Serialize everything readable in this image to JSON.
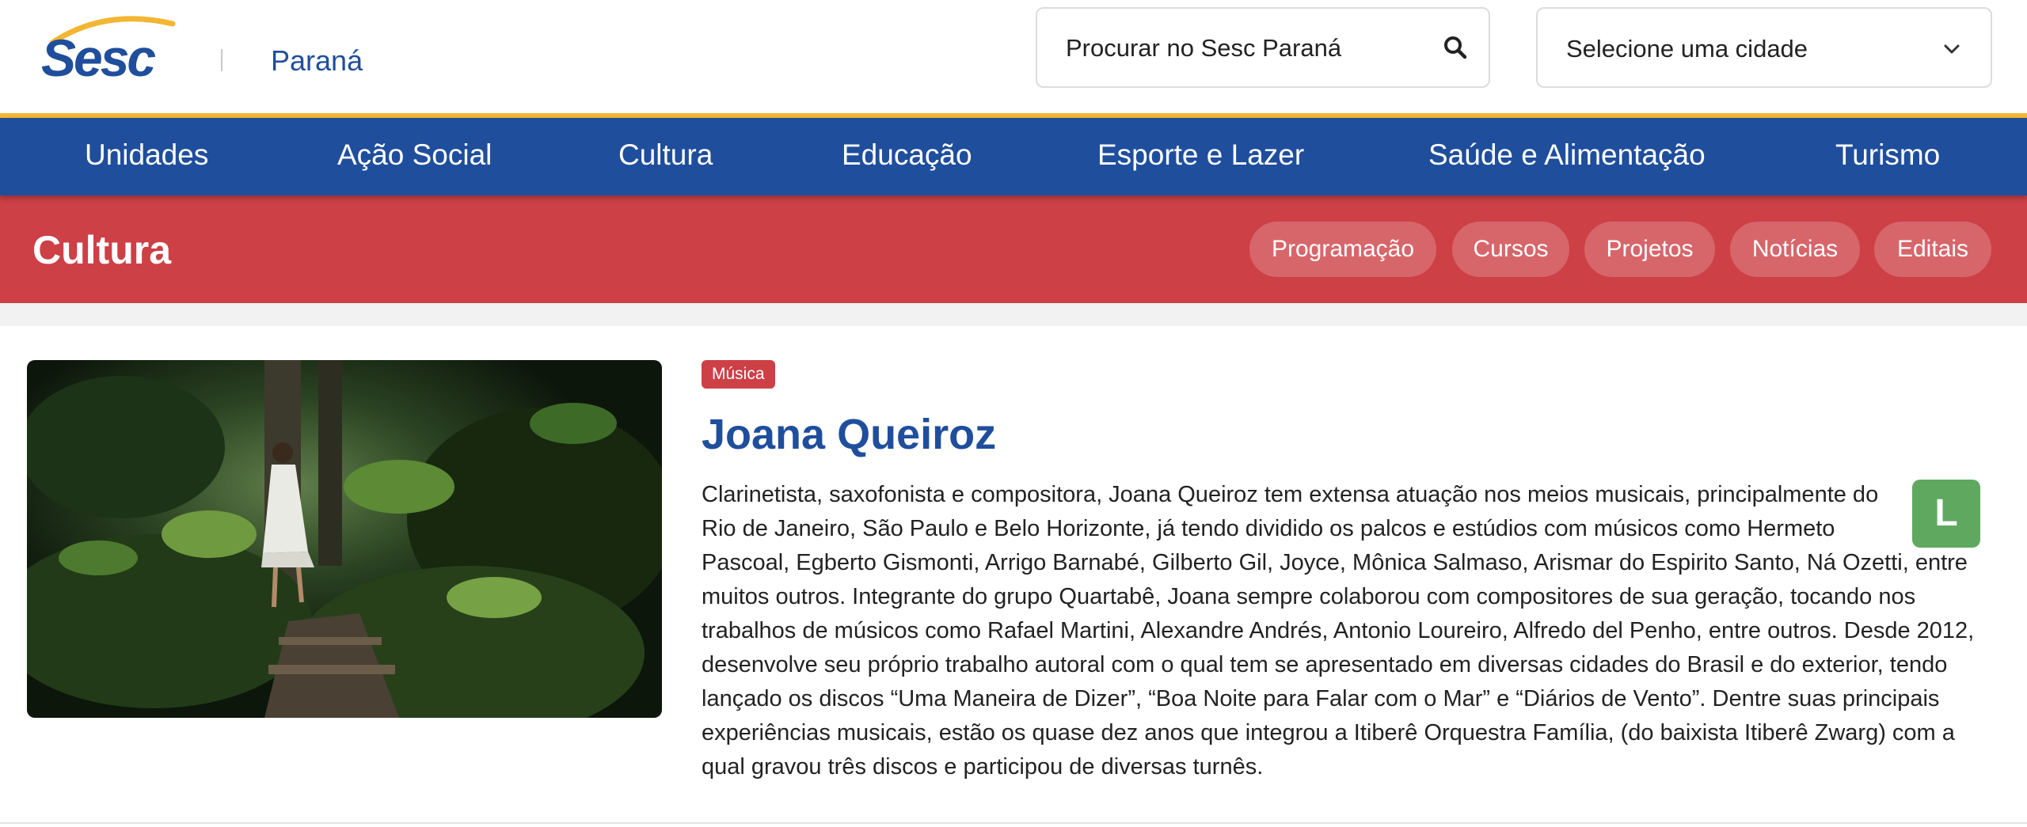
{
  "header": {
    "logo_text": "Sesc",
    "region": "Paraná",
    "search_placeholder": "Procurar no Sesc Paraná",
    "city_select": "Selecione uma cidade"
  },
  "main_nav": [
    "Unidades",
    "Ação Social",
    "Cultura",
    "Educação",
    "Esporte e Lazer",
    "Saúde e Alimentação",
    "Turismo"
  ],
  "section": {
    "title": "Cultura",
    "links": [
      "Programação",
      "Cursos",
      "Projetos",
      "Notícias",
      "Editais"
    ]
  },
  "article": {
    "tag": "Música",
    "title": "Joana Queiroz",
    "rating": "L",
    "description": "Clarinetista, saxofonista e compositora, Joana Queiroz tem extensa atuação nos meios musicais, principalmente do Rio de Janeiro, São Paulo e Belo Horizonte, já tendo dividido os palcos e estúdios com músicos como Hermeto Pascoal, Egberto Gismonti, Arrigo Barnabé, Gilberto Gil, Joyce, Mônica Salmaso, Arismar do Espirito Santo, Ná Ozetti, entre muitos outros. Integrante do grupo Quartabê, Joana sempre colaborou com compositores de sua geração, tocando nos trabalhos de músicos como Rafael Martini, Alexandre Andrés, Antonio Loureiro, Alfredo del Penho, entre outros. Desde 2012, desenvolve seu próprio trabalho autoral com o qual tem se apresentado em diversas cidades do Brasil e do exterior, tendo lançado os discos “Uma Maneira de Dizer”, “Boa Noite para Falar com o Mar” e “Diários de Vento”. Dentre suas principais experiências musicais, estão os quase dez anos que integrou a Itiberê Orquestra Família, (do baixista Itiberê Zwarg) com a qual gravou três discos e participou de diversas turnês."
  },
  "colors": {
    "brand_blue": "#1f4e9c",
    "brand_gold": "#f3b632",
    "culture_red": "#cd4046",
    "rating_green": "#5fa860"
  },
  "icons": [
    "sesc-logo",
    "search-icon",
    "chevron-down-icon"
  ]
}
